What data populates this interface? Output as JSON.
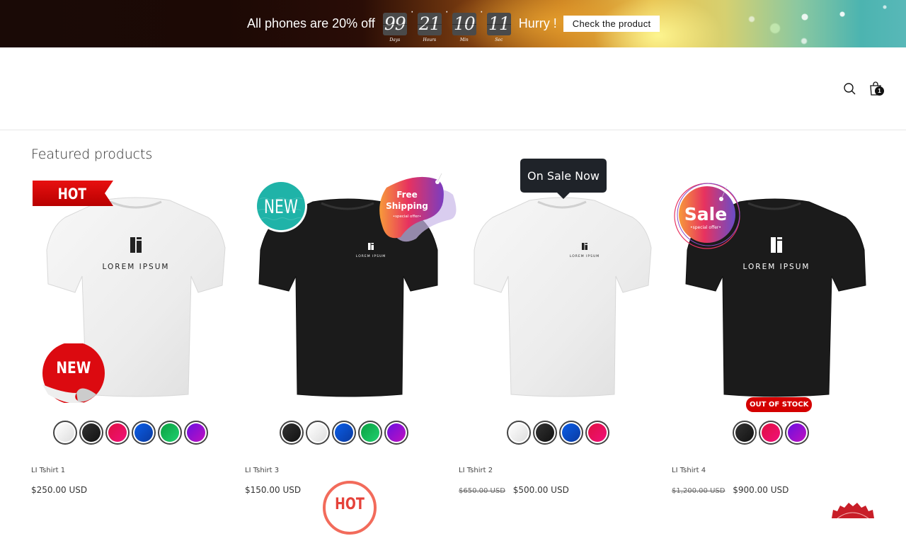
{
  "announcement": {
    "text": "All phones are 20% off",
    "countdown": [
      {
        "value": "99",
        "label": "Days"
      },
      {
        "value": "21",
        "label": "Hours"
      },
      {
        "value": "10",
        "label": "Min"
      },
      {
        "value": "11",
        "label": "Sec"
      }
    ],
    "separator": "·",
    "hurry": "Hurry !",
    "cta": "Check the product"
  },
  "header": {
    "search_icon": "search-icon",
    "cart_icon": "bag-icon",
    "cart_count": "1"
  },
  "section": {
    "title": "Featured products"
  },
  "products": [
    {
      "title": "LI Tshirt 1",
      "price": "$250.00 USD",
      "old_price": "",
      "shirt_color": "white",
      "logo_text": "LOREM IPSUM",
      "badges": [
        "HOT",
        "NEW"
      ],
      "swatches": [
        "#efefef",
        "#1a1a1a",
        "#e0104f",
        "#0b55d0",
        "#10b050",
        "#8a10d0"
      ]
    },
    {
      "title": "LI Tshirt 3",
      "price": "$150.00 USD",
      "old_price": "",
      "shirt_color": "black",
      "logo_text": "LOREM IPSUM",
      "badges": [
        "NEW",
        "Free Shipping",
        "HOT"
      ],
      "badge_free_line1": "Free",
      "badge_free_line2": "Shipping",
      "badge_free_sub": "•special offer•",
      "swatches": [
        "#1a1a1a",
        "#efefef",
        "#0b55d0",
        "#10b050",
        "#8a10d0"
      ]
    },
    {
      "title": "LI Tshirt 2",
      "price": "$500.00 USD",
      "old_price": "$650.00 USD",
      "shirt_color": "white",
      "logo_text": "LOREM IPSUM",
      "badges": [
        "On Sale Now"
      ],
      "swatches": [
        "#efefef",
        "#1a1a1a",
        "#0b55d0",
        "#e0104f"
      ]
    },
    {
      "title": "LI Tshirt 4",
      "price": "$900.00 USD",
      "old_price": "$1,200.00 USD",
      "shirt_color": "black",
      "logo_text": "LOREM IPSUM",
      "badges": [
        "Sale",
        "OUT OF STOCK"
      ],
      "badge_sale_sub": "•special offer•",
      "swatches": [
        "#1a1a1a",
        "#e0104f",
        "#8a10d0"
      ]
    }
  ],
  "badge_text": {
    "hot": "HOT",
    "new": "NEW",
    "on_sale": "On Sale Now",
    "sale": "Sale",
    "out_of_stock": "OUT OF STOCK"
  },
  "colors": {
    "badge_red": "#d40000",
    "badge_teal": "#1fb3a8",
    "tooltip_dark": "#1f2329",
    "hot_circle": "#f26b5b"
  }
}
